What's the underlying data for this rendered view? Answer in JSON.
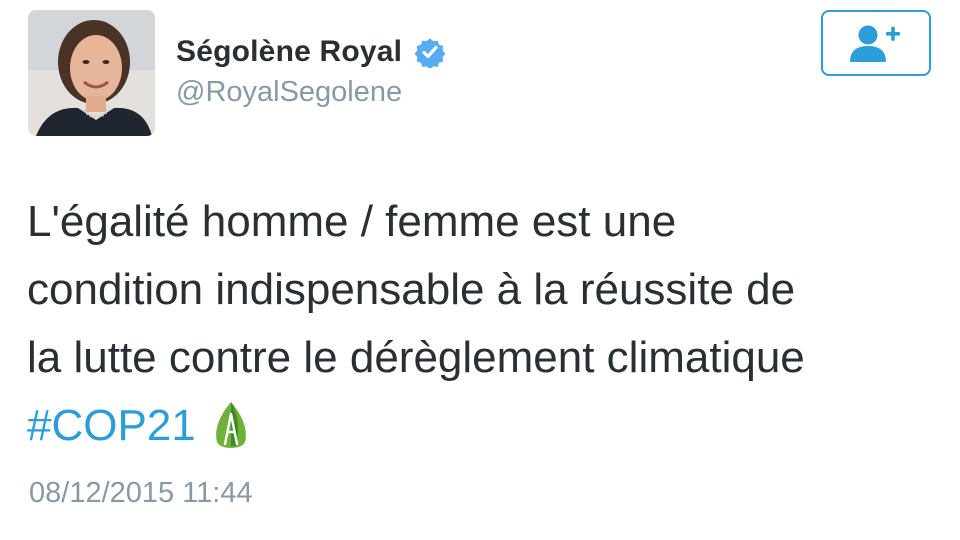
{
  "tweet": {
    "author": {
      "display_name": "Ségolène Royal",
      "handle": "@RoyalSegolene",
      "verified": true
    },
    "text_lines": [
      "L'égalité homme / femme est une",
      "condition indispensable à la réussite de",
      "la lutte contre le dérèglement climatique"
    ],
    "hashtag": "#COP21",
    "emoji": "cop21-leaf-icon",
    "timestamp": "08/12/2015 11:44"
  },
  "follow_button": {
    "icon": "add-user-icon"
  },
  "colors": {
    "link": "#2b9ed9",
    "text": "#292f33",
    "secondary": "#8899a6",
    "verified": "#55acee"
  }
}
